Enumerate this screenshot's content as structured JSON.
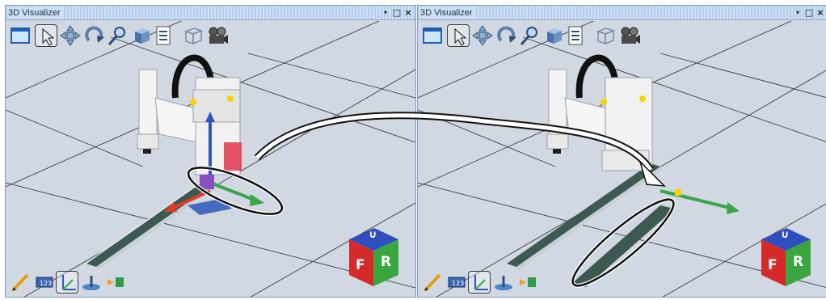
{
  "panels": [
    {
      "title": "3D Visualizer",
      "controls": {
        "dropdown": "▾",
        "maximize": "□",
        "close": "×"
      },
      "top_toolbar": [
        "window-icon",
        "select-arrow-icon",
        "pan-icon",
        "rotate-icon",
        "zoom-icon",
        "solid-view-icon",
        "properties-icon",
        "wireframe-view-icon",
        "camera-icon"
      ],
      "active_top_tool": "select-arrow-icon",
      "bottom_toolbar": [
        "edit-pencil-icon",
        "display-icon",
        "axes-icon",
        "ground-icon",
        "marker-icon"
      ],
      "active_bottom_tool": "axes-icon",
      "viewcube": {
        "top": "∪",
        "front": "F",
        "right": "R"
      }
    },
    {
      "title": "3D Visualizer",
      "controls": {
        "dropdown": "▾",
        "maximize": "□",
        "close": "×"
      },
      "top_toolbar": [
        "window-icon",
        "select-arrow-icon",
        "pan-icon",
        "rotate-icon",
        "zoom-icon",
        "solid-view-icon",
        "properties-icon",
        "wireframe-view-icon",
        "camera-icon"
      ],
      "active_top_tool": "select-arrow-icon",
      "bottom_toolbar": [
        "edit-pencil-icon",
        "display-icon",
        "axes-icon",
        "ground-icon",
        "marker-icon"
      ],
      "active_bottom_tool": "axes-icon",
      "viewcube": {
        "top": "∪",
        "front": "F",
        "right": "R"
      }
    }
  ],
  "colors": {
    "titlebar": "#cfe0f4",
    "viewport_floor": "#d2d8e2",
    "conveyor": "#3d5a52",
    "axis_x": "#e03a2a",
    "axis_y": "#3aa64a",
    "axis_z": "#2c58b8",
    "cube_top": "#2f4fc0",
    "cube_front": "#d62a2a",
    "cube_right": "#3aa640"
  }
}
